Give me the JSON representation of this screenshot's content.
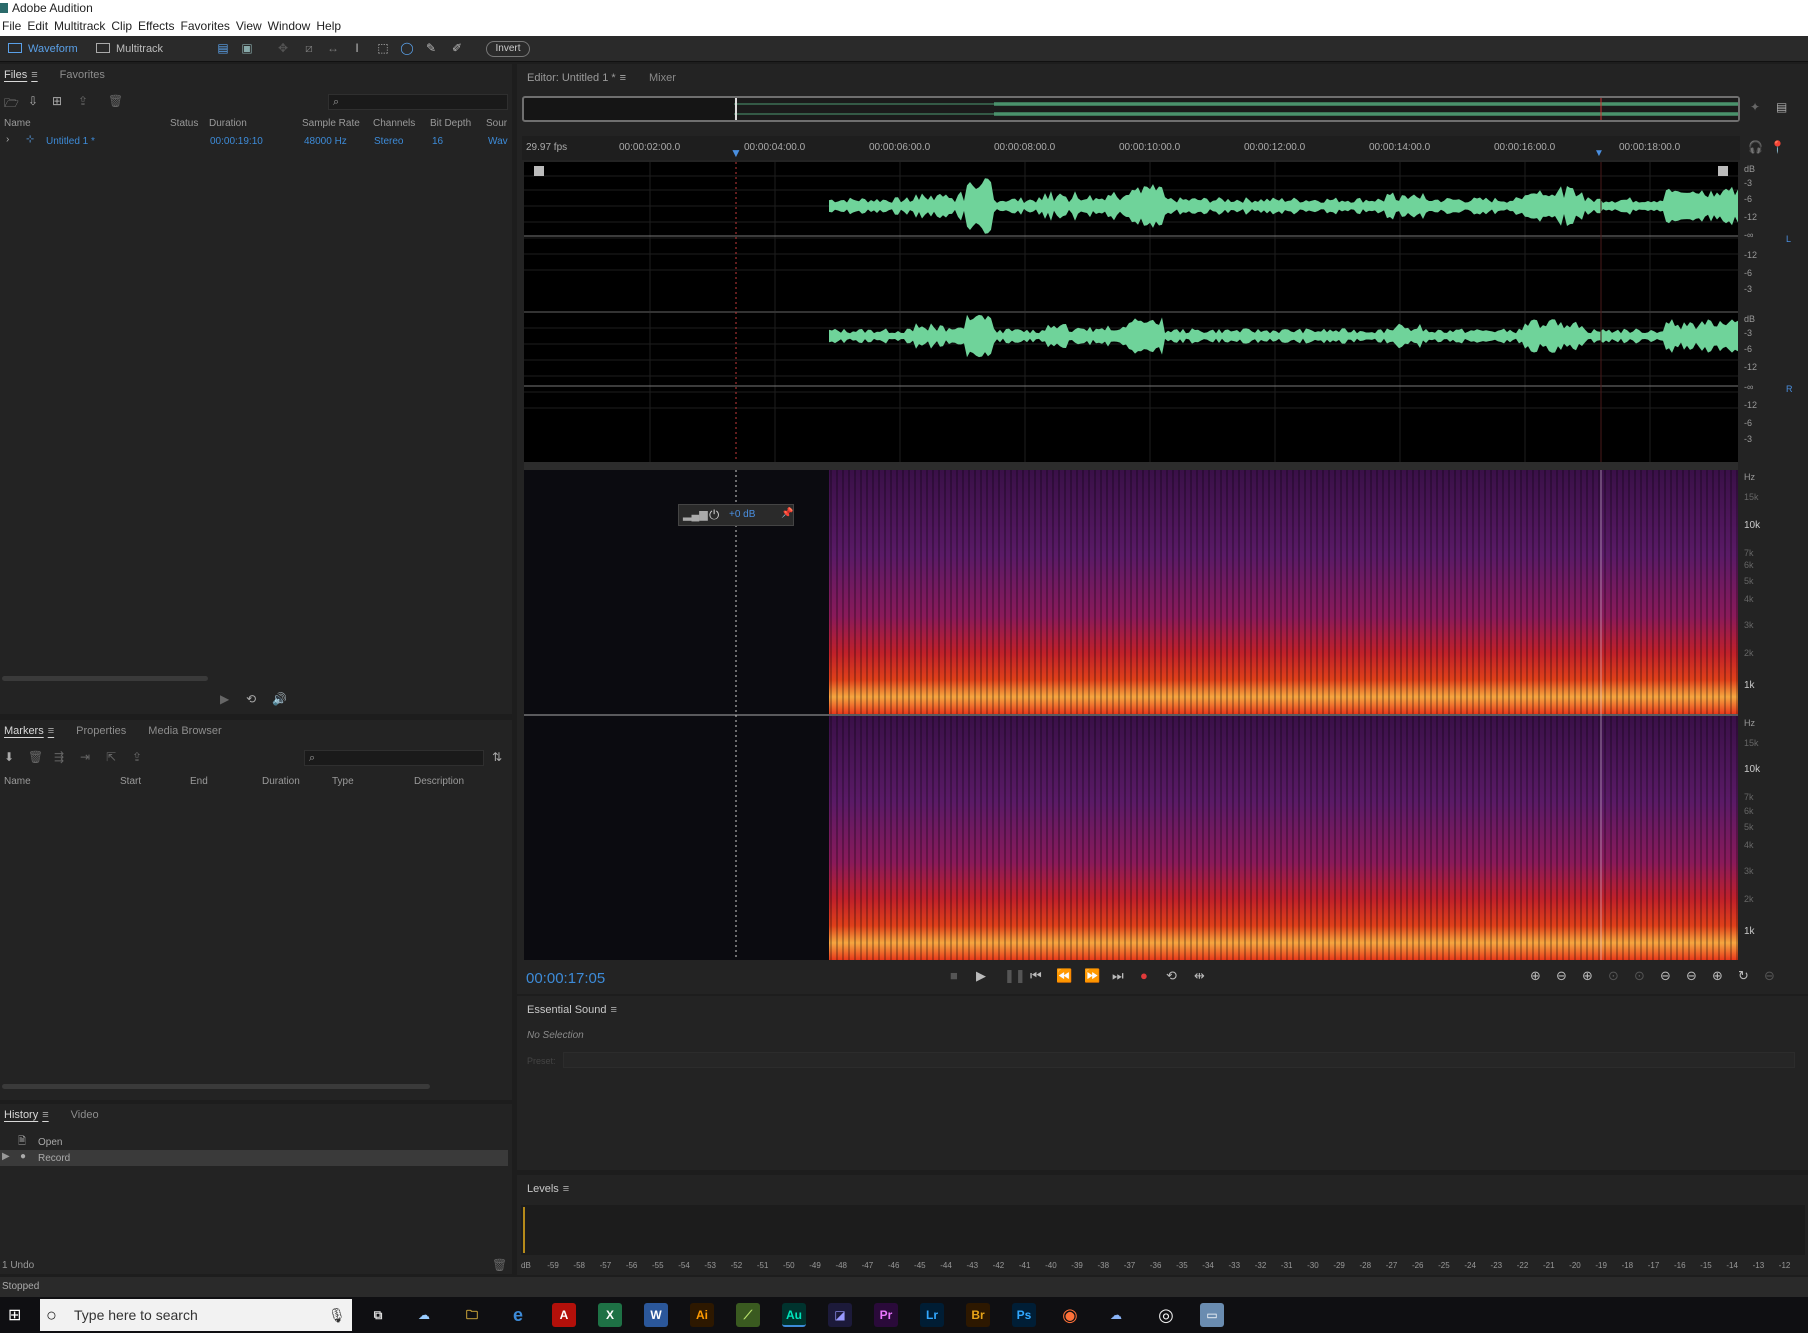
{
  "window": {
    "title": "Adobe Audition"
  },
  "menu": [
    "File",
    "Edit",
    "Multitrack",
    "Clip",
    "Effects",
    "Favorites",
    "View",
    "Window",
    "Help"
  ],
  "toolbar": {
    "waveform_label": "Waveform",
    "multitrack_label": "Multitrack",
    "invert_label": "Invert"
  },
  "files_panel": {
    "tabs": [
      "Files",
      "Favorites"
    ],
    "columns": [
      "Name",
      "Status",
      "Duration",
      "Sample Rate",
      "Channels",
      "Bit Depth",
      "Sour"
    ],
    "rows": [
      {
        "name": "Untitled 1 *",
        "status": "",
        "duration": "00:00:19:10",
        "sample_rate": "48000 Hz",
        "channels": "Stereo",
        "bit_depth": "16",
        "source": "Wav"
      }
    ]
  },
  "markers_panel": {
    "tabs": [
      "Markers",
      "Properties",
      "Media Browser"
    ],
    "columns": [
      "Name",
      "Start",
      "End",
      "Duration",
      "Type",
      "Description"
    ]
  },
  "history_panel": {
    "tabs": [
      "History",
      "Video"
    ],
    "items": [
      "Open",
      "Record"
    ],
    "undo_label": "1 Undo"
  },
  "editor": {
    "tab_label": "Editor: Untitled 1 *",
    "mixer_label": "Mixer",
    "fps": "29.97 fps",
    "ruler_ticks": [
      "00:00:02:00.0",
      "00:00:04:00.0",
      "00:00:06:00.0",
      "00:00:08:00.0",
      "00:00:10:00.0",
      "00:00:12:00.0",
      "00:00:14:00.0",
      "00:00:16:00.0",
      "00:00:18:00.0"
    ],
    "db_scale_left": [
      "dB",
      "-3",
      "-6",
      "-12",
      "-∞",
      "-12",
      "-6",
      "-3"
    ],
    "db_scale_right": [
      "dB",
      "-3",
      "-6",
      "-12",
      "-∞",
      "-12",
      "-6",
      "-3"
    ],
    "channel_l": "L",
    "channel_r": "R",
    "hz_scale_top": [
      "Hz",
      "15k",
      "10k",
      "7k",
      "6k",
      "5k",
      "4k",
      "3k",
      "2k",
      "1k"
    ],
    "hz_scale_bottom": [
      "Hz",
      "15k",
      "10k",
      "7k",
      "6k",
      "5k",
      "4k",
      "3k",
      "2k",
      "1k"
    ],
    "gain_hud": "+0 dB",
    "timecode": "00:00:17:05",
    "colors": {
      "waveform": "#6fd39a",
      "accent": "#3d8bd8",
      "record": "#e03a3a"
    }
  },
  "essential_sound": {
    "title": "Essential Sound",
    "no_selection": "No Selection",
    "preset_label": "Preset:"
  },
  "levels": {
    "title": "Levels",
    "scale": [
      "dB",
      "-59",
      "-58",
      "-57",
      "-56",
      "-55",
      "-54",
      "-53",
      "-52",
      "-51",
      "-50",
      "-49",
      "-48",
      "-47",
      "-46",
      "-45",
      "-44",
      "-43",
      "-42",
      "-41",
      "-40",
      "-39",
      "-38",
      "-37",
      "-36",
      "-35",
      "-34",
      "-33",
      "-32",
      "-31",
      "-30",
      "-29",
      "-28",
      "-27",
      "-26",
      "-25",
      "-24",
      "-23",
      "-22",
      "-21",
      "-20",
      "-19",
      "-18",
      "-17",
      "-16",
      "-15",
      "-14",
      "-13",
      "-12"
    ]
  },
  "status": {
    "text": "Stopped"
  },
  "taskbar": {
    "search_placeholder": "Type here to search",
    "apps": [
      "Ai",
      "Au",
      "Pr",
      "Lr",
      "Br",
      "Ps"
    ]
  }
}
